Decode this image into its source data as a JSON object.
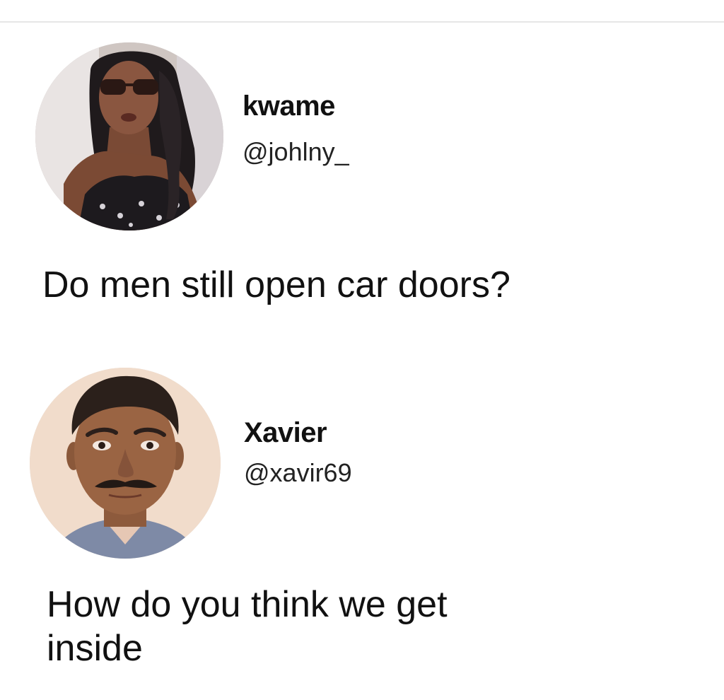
{
  "posts": [
    {
      "author": {
        "name": "kwame",
        "handle": "@johlny_",
        "avatar_icon": "avatar-photo-woman"
      },
      "text": "Do men still open car doors?"
    },
    {
      "author": {
        "name": "Xavier",
        "handle": "@xavir69",
        "avatar_icon": "avatar-photo-man"
      },
      "text_lines": [
        "How do you think we get",
        "inside"
      ]
    }
  ],
  "colors": {
    "background": "#ffffff",
    "text": "#111111",
    "divider": "#e6e6e6"
  }
}
